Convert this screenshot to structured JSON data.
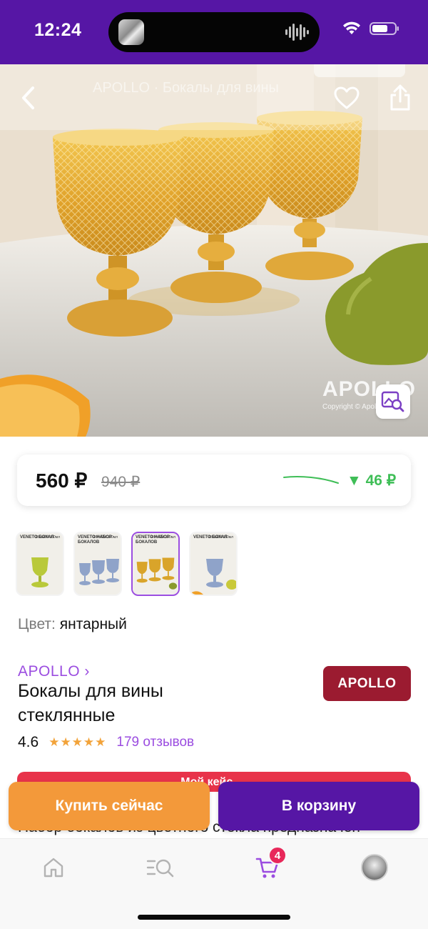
{
  "status_bar": {
    "time": "12:24"
  },
  "hero": {
    "faded_title": "APOLLO · Бокалы для вины",
    "watermark_logo": "APOLLO",
    "watermark_copy": "Copyright © Apollo"
  },
  "price": {
    "current": "560 ₽",
    "old": "940 ₽",
    "drop": "▼ 46 ₽"
  },
  "thumbnails": [
    {
      "title": "VENETO БОКАЛ",
      "badge": "ОБЪЁМ 350мл",
      "glass_color": "#b9c93a",
      "selected": false
    },
    {
      "title": "VENETO НАБОР БОКАЛОВ",
      "badge": "ОБЪЁМ 350мл",
      "glass_color": "#8fa3c9",
      "selected": false
    },
    {
      "title": "VENETO НАБОР БОКАЛОВ",
      "badge": "ОБЪЁМ 350мл",
      "glass_color": "#d9a42a",
      "selected": true
    },
    {
      "title": "VENETO БОКАЛ",
      "badge": "ОБЪЁМ 350мл",
      "glass_color": "#8fa3c9",
      "selected": false
    }
  ],
  "color": {
    "label": "Цвет:",
    "value": "янтарный"
  },
  "product": {
    "brand_link": "APOLLO ›",
    "brand_logo": "APOLLO",
    "title": "Бокалы для вины стеклянные",
    "rating": "4.6",
    "stars": "★★★★★",
    "reviews": "179 отзывов"
  },
  "promo": {
    "text": "Мой кейс →"
  },
  "description": "Набор бокалов из цветного стекла предназначен",
  "actions": {
    "buy_now": "Купить сейчас",
    "add_to_cart": "В корзину"
  },
  "tab_bar": {
    "cart_count": "4"
  },
  "colors": {
    "brand_purple": "#5616a5",
    "accent_purple": "#9b4de0",
    "orange": "#f3993a",
    "price_drop_green": "#3fbe57",
    "badge_red": "#e8285a",
    "brand_logo_bg": "#9b1b30"
  }
}
